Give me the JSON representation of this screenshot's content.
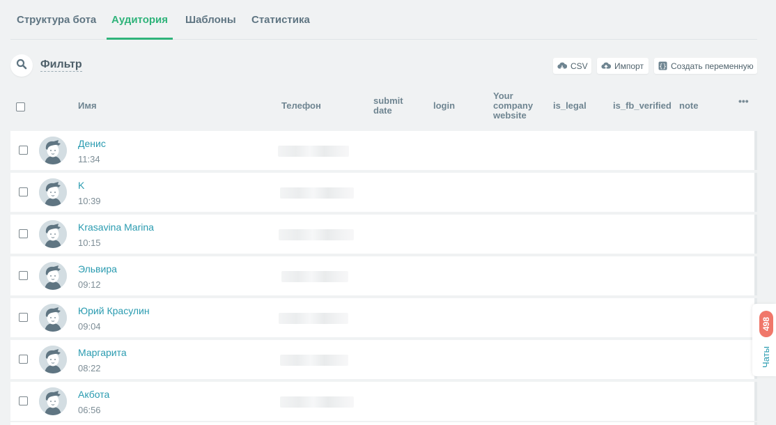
{
  "tabs": [
    {
      "label": "Структура бота",
      "active": false
    },
    {
      "label": "Аудитория",
      "active": true
    },
    {
      "label": "Шаблоны",
      "active": false
    },
    {
      "label": "Статистика",
      "active": false
    }
  ],
  "filter": {
    "label": "Фильтр",
    "search_icon": "search-icon"
  },
  "toolbar": {
    "csv_label": "CSV",
    "import_label": "Импорт",
    "create_variable_label": "Создать переменную"
  },
  "table": {
    "columns": {
      "name": "Имя",
      "phone": "Телефон",
      "submit_date_1": "submit",
      "submit_date_2": "date",
      "login": "login",
      "website_1": "Your",
      "website_2": "company",
      "website_3": "website",
      "is_legal": "is_legal",
      "is_fb_verified": "is_fb_verified",
      "note": "note",
      "more": "•••"
    },
    "rows": [
      {
        "name": "Денис",
        "time": "11:34"
      },
      {
        "name": "K",
        "time": "10:39"
      },
      {
        "name": "Krasavina Marina",
        "time": "10:15"
      },
      {
        "name": "Эльвира",
        "time": "09:12"
      },
      {
        "name": "Юрий Красулин",
        "time": "09:04"
      },
      {
        "name": "Маргарита",
        "time": "08:22"
      },
      {
        "name": "Акбота",
        "time": "06:56"
      }
    ]
  },
  "chats": {
    "label": "Чаты",
    "count": "498"
  },
  "colors": {
    "accent": "#2fb37a",
    "link": "#2a9bb0",
    "badge": "#f0776a"
  }
}
